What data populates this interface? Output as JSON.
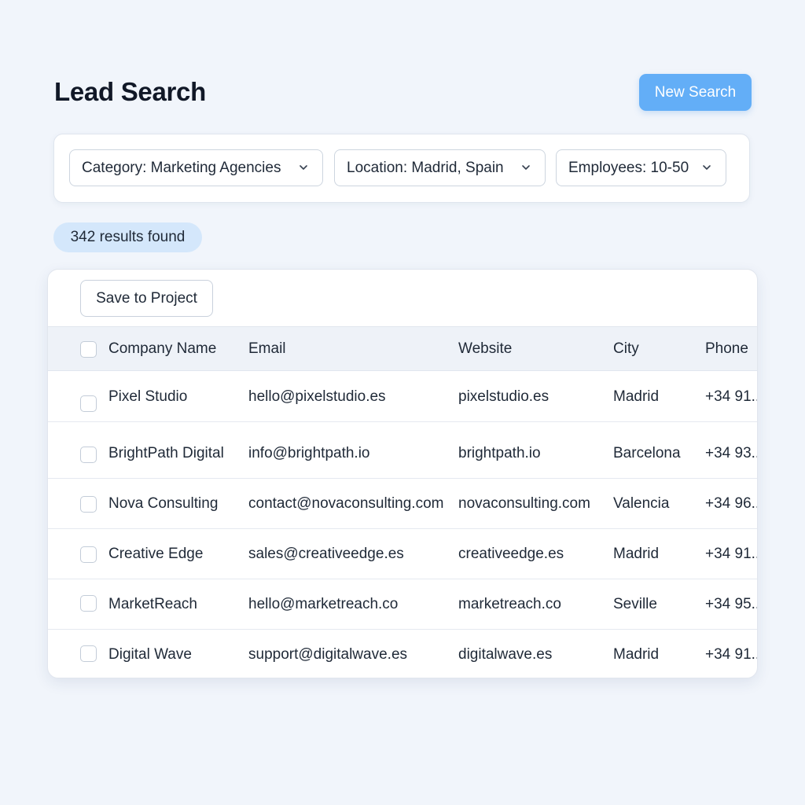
{
  "header": {
    "title": "Lead Search",
    "new_search_label": "New Search",
    "accent_color": "#63aef7"
  },
  "filters": [
    {
      "label": "Category: Marketing Agencies"
    },
    {
      "label": "Location: Madrid, Spain"
    },
    {
      "label": "Employees: 10-50"
    }
  ],
  "results": {
    "count_text": "342 results found"
  },
  "table": {
    "save_label": "Save to Project",
    "columns": [
      "Company Name",
      "Email",
      "Website",
      "City",
      "Phone"
    ],
    "rows": [
      {
        "company": "Pixel Studio",
        "email": "hello@pixelstudio.es",
        "website": "pixelstudio.es",
        "city": "Madrid",
        "phone": "+34 91.."
      },
      {
        "company": "BrightPath Digital",
        "email": "info@brightpath.io",
        "website": "brightpath.io",
        "city": "Barcelona",
        "phone": "+34 93.."
      },
      {
        "company": "Nova Consulting",
        "email": "contact@novaconsulting.com",
        "website": "novaconsulting.com",
        "city": "Valencia",
        "phone": "+34 96.."
      },
      {
        "company": "Creative Edge",
        "email": "sales@creativeedge.es",
        "website": "creativeedge.es",
        "city": "Madrid",
        "phone": "+34 91.."
      },
      {
        "company": "MarketReach",
        "email": "hello@marketreach.co",
        "website": "marketreach.co",
        "city": "Seville",
        "phone": "+34 95.."
      },
      {
        "company": "Digital Wave",
        "email": "support@digitalwave.es",
        "website": "digitalwave.es",
        "city": "Madrid",
        "phone": "+34 91.."
      }
    ]
  }
}
